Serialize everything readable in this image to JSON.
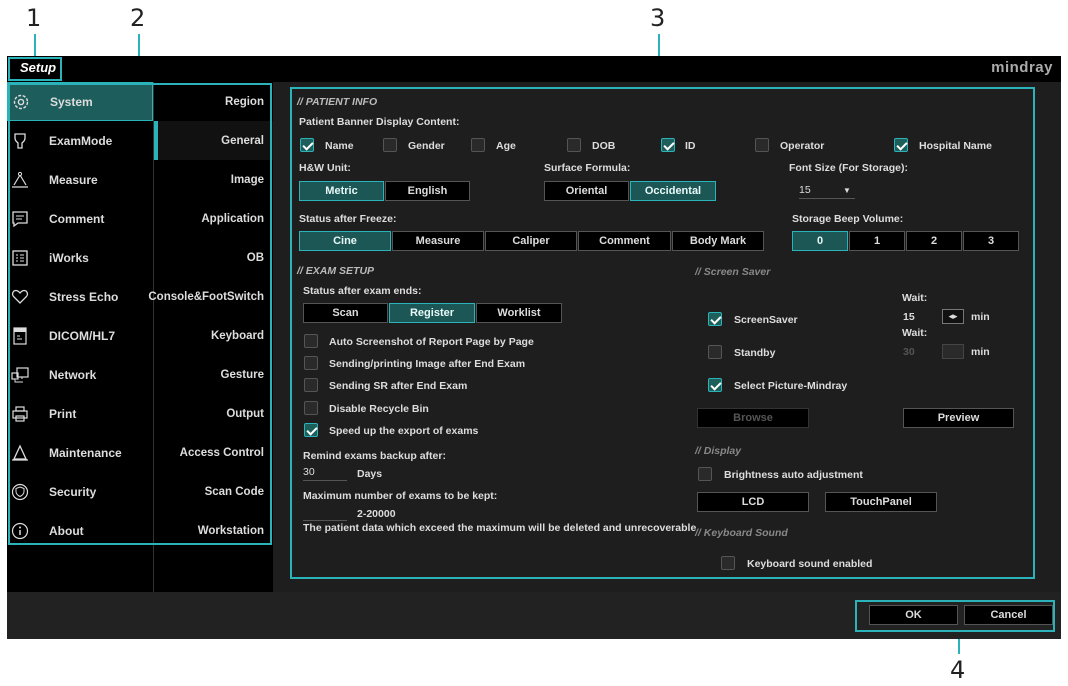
{
  "callouts": [
    "1",
    "2",
    "3",
    "4"
  ],
  "app": {
    "title": "Setup",
    "logo": "mindray"
  },
  "nav": [
    {
      "label": "System",
      "icon": "gear-icon",
      "active": true
    },
    {
      "label": "ExamMode",
      "icon": "probe-icon"
    },
    {
      "label": "Measure",
      "icon": "caliper-icon"
    },
    {
      "label": "Comment",
      "icon": "comment-icon"
    },
    {
      "label": "iWorks",
      "icon": "list-icon"
    },
    {
      "label": "Stress Echo",
      "icon": "heart-icon"
    },
    {
      "label": "DICOM/HL7",
      "icon": "dicom-icon"
    },
    {
      "label": "Network",
      "icon": "network-icon"
    },
    {
      "label": "Print",
      "icon": "printer-icon"
    },
    {
      "label": "Maintenance",
      "icon": "maintenance-icon"
    },
    {
      "label": "Security",
      "icon": "shield-icon"
    },
    {
      "label": "About",
      "icon": "info-icon"
    }
  ],
  "subnav": [
    "Region",
    "General",
    "Image",
    "Application",
    "OB",
    "Console&FootSwitch",
    "Keyboard",
    "Gesture",
    "Output",
    "Access Control",
    "Scan Code",
    "Workstation"
  ],
  "patient": {
    "section": "PATIENT INFO",
    "banner_label": "Patient Banner Display Content:",
    "banner_items": [
      {
        "label": "Name",
        "on": true
      },
      {
        "label": "Gender",
        "on": false
      },
      {
        "label": "Age",
        "on": false
      },
      {
        "label": "DOB",
        "on": false
      },
      {
        "label": "ID",
        "on": true
      },
      {
        "label": "Operator",
        "on": false
      },
      {
        "label": "Hospital Name",
        "on": true
      }
    ],
    "hw_label": "H&W Unit:",
    "hw_options": [
      "Metric",
      "English"
    ],
    "surface_label": "Surface Formula:",
    "surface_options": [
      "Oriental",
      "Occidental"
    ],
    "font_label": "Font Size (For Storage):",
    "font_value": "15",
    "freeze_label": "Status after Freeze:",
    "freeze_options": [
      "Cine",
      "Measure",
      "Caliper",
      "Comment",
      "Body Mark"
    ],
    "beep_label": "Storage Beep Volume:",
    "beep_options": [
      "0",
      "1",
      "2",
      "3"
    ]
  },
  "exam": {
    "section": "EXAM SETUP",
    "ends_label": "Status after exam ends:",
    "ends_options": [
      "Scan",
      "Register",
      "Worklist"
    ],
    "checks": [
      {
        "label": "Auto Screenshot of Report Page by Page",
        "on": false
      },
      {
        "label": "Sending/printing Image after End Exam",
        "on": false
      },
      {
        "label": "Sending SR after End Exam",
        "on": false
      },
      {
        "label": "Disable Recycle Bin",
        "on": false
      },
      {
        "label": "Speed up the export of exams",
        "on": true
      }
    ],
    "remind_label": "Remind exams backup after:",
    "remind_value": "30",
    "remind_unit": "Days",
    "max_label": "Maximum number of exams to be kept:",
    "max_range": "2-20000",
    "warning": "The patient data which exceed the maximum will be deleted and unrecoverable"
  },
  "saver": {
    "section": "Screen Saver",
    "wait1": "Wait:",
    "wait2": "Wait:",
    "screensaver_label": "ScreenSaver",
    "screensaver_on": true,
    "screensaver_value": "15",
    "min1": "min",
    "standby_label": "Standby",
    "standby_on": false,
    "standby_value": "30",
    "min2": "min",
    "picture_label": "Select Picture-Mindray",
    "picture_on": true,
    "browse": "Browse",
    "preview": "Preview"
  },
  "display": {
    "section": "Display",
    "brightness_label": "Brightness auto adjustment",
    "lcd": "LCD",
    "touch": "TouchPanel"
  },
  "keyboard": {
    "section": "Keyboard Sound",
    "enabled_label": "Keyboard sound enabled"
  },
  "footer": {
    "ok": "OK",
    "cancel": "Cancel"
  },
  "colors": {
    "accent": "#2bb3b9",
    "active_fill": "#1c5756"
  }
}
